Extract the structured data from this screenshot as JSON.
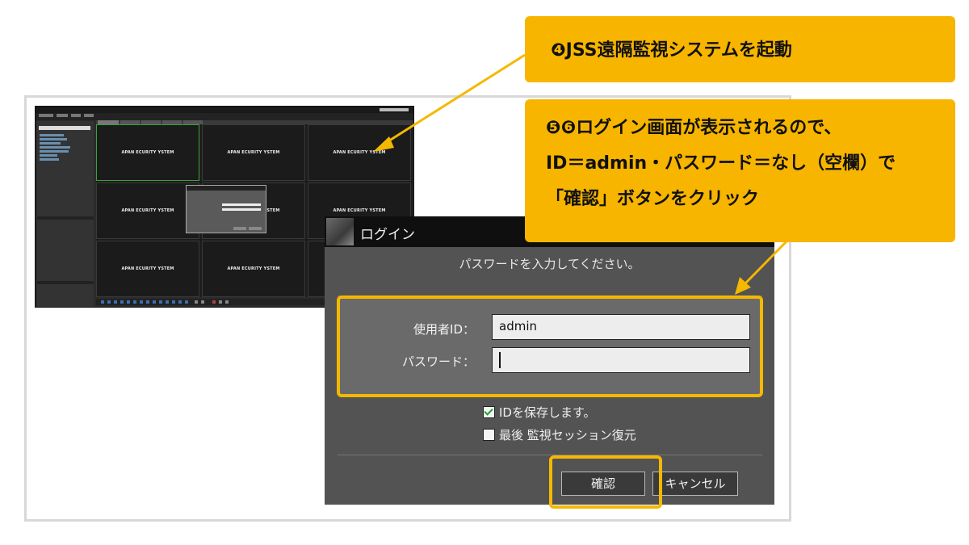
{
  "callouts": {
    "step4": "❹JSS遠隔監視システムを起動",
    "step56_line1": "❺❻ログイン画面が表示されるので、",
    "step56_line2": "ID＝admin・パスワード＝なし（空欄）で",
    "step56_line3": "「確認」ボタンをクリック"
  },
  "mini_app": {
    "cell_logo": "APAN ECURITY YSTEM"
  },
  "login": {
    "title": "ログイン",
    "prompt": "パスワードを入力してください。",
    "user_id_label": "使用者ID：",
    "user_id_value": "admin",
    "password_label": "パスワード：",
    "save_id_label": "IDを保存します。",
    "save_id_checked": true,
    "restore_session_label": "最後 監視セッション復元",
    "restore_session_checked": false,
    "confirm_button": "確認",
    "cancel_button": "キャンセル"
  },
  "colors": {
    "callout": "#f7b500",
    "highlight": "#f5b800",
    "dialog_bg": "#535353"
  }
}
